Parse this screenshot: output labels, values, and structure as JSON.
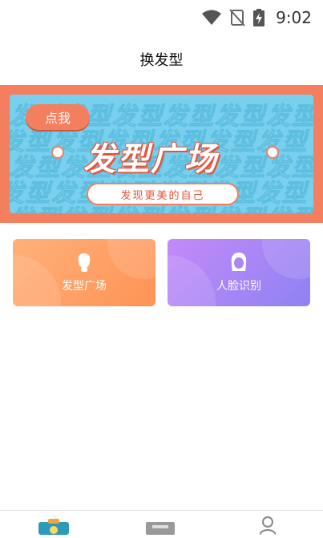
{
  "status_bar": {
    "time": "9:02",
    "wifi_icon": "wifi-icon",
    "signal_icon": "no-signal-icon",
    "battery_icon": "battery-charging-icon"
  },
  "header": {
    "title": "换发型"
  },
  "banner": {
    "pattern_text": "发型发型发型发型发型发型",
    "badge": "点我",
    "title": "发型广场",
    "subtitle": "发现更美的自己",
    "colors": {
      "frame": "#f47f5f",
      "background": "#78cfee"
    }
  },
  "cards": [
    {
      "label": "发型广场",
      "icon": "hair-head-icon"
    },
    {
      "label": "人脸识别",
      "icon": "face-woman-icon"
    }
  ],
  "bottom_nav": {
    "items": [
      "camera-icon",
      "id-card-icon",
      "profile-icon"
    ]
  }
}
